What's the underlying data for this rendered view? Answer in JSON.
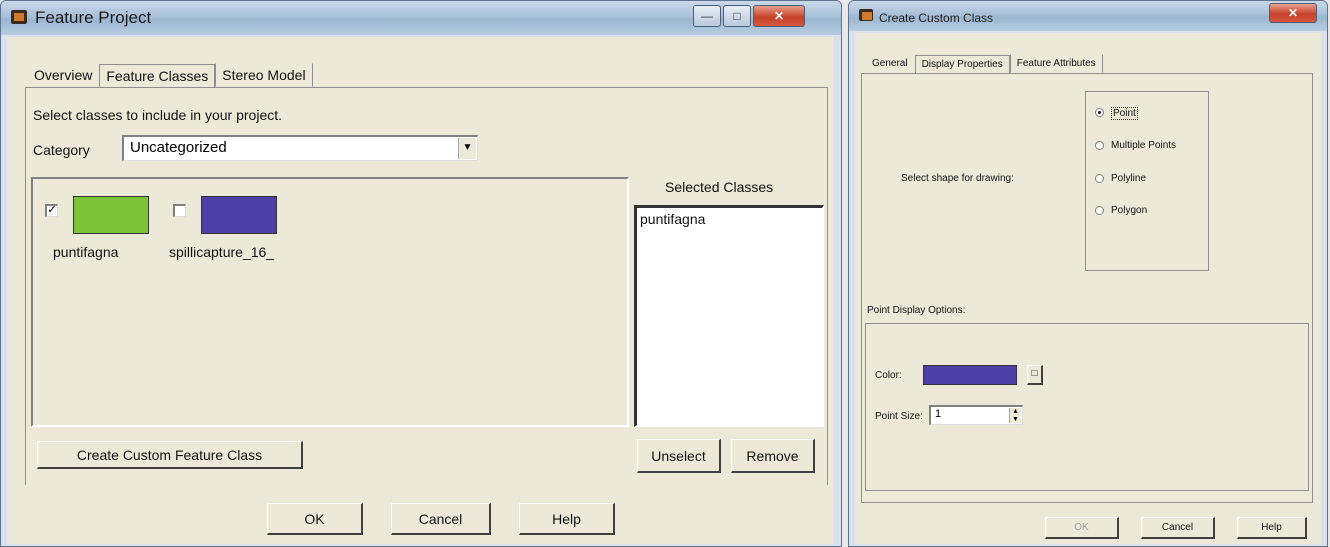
{
  "feature_project": {
    "title": "Feature Project",
    "tabs": [
      "Overview",
      "Feature Classes",
      "Stereo Model"
    ],
    "instructions": "Select classes to include in your project.",
    "category_label": "Category",
    "category_value": "Uncategorized",
    "classes": [
      {
        "name": "puntifagna",
        "checked": true,
        "color": "#7dc33a"
      },
      {
        "name": "spillicapture_16_",
        "checked": false,
        "color": "#4e3fa6"
      }
    ],
    "selected_classes_label": "Selected Classes",
    "selected_classes": [
      "puntifagna"
    ],
    "create_button": "Create Custom Feature Class",
    "unselect_button": "Unselect",
    "remove_button": "Remove",
    "ok_button": "OK",
    "cancel_button": "Cancel",
    "help_button": "Help"
  },
  "create_custom_class": {
    "title": "Create Custom Class",
    "tabs": [
      "General",
      "Display Properties",
      "Feature Attributes"
    ],
    "shape_label": "Select shape for drawing:",
    "shapes": [
      {
        "label": "Point",
        "selected": true
      },
      {
        "label": "Multiple Points",
        "selected": false
      },
      {
        "label": "Polyline",
        "selected": false
      },
      {
        "label": "Polygon",
        "selected": false
      }
    ],
    "point_display_label": "Point Display Options:",
    "color_label": "Color:",
    "color_value": "#4e3fa6",
    "point_size_label": "Point Size:",
    "point_size_value": "1",
    "ok_button": "OK",
    "cancel_button": "Cancel",
    "help_button": "Help"
  }
}
